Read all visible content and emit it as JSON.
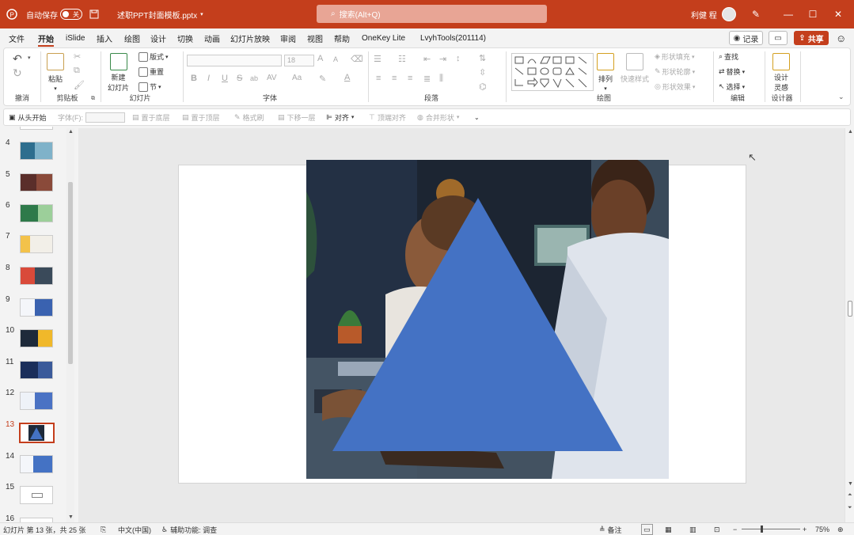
{
  "titlebar": {
    "autosave_label": "自动保存",
    "autosave_state": "关",
    "filename": "述职PPT封面模板.pptx",
    "search_placeholder": "搜索(Alt+Q)",
    "user_name": "利健 程"
  },
  "tabs": [
    "文件",
    "开始",
    "iSlide",
    "插入",
    "绘图",
    "设计",
    "切换",
    "动画",
    "幻灯片放映",
    "审阅",
    "视图",
    "帮助",
    "OneKey Lite",
    "LvyhTools(201114)"
  ],
  "record_label": "记录",
  "share_label": "共享",
  "ribbon": {
    "groups": [
      "撤消",
      "剪贴板",
      "幻灯片",
      "字体",
      "段落",
      "绘图",
      "编辑",
      "设计器"
    ],
    "paste": "粘贴",
    "new_slide": [
      "新建",
      "幻灯片"
    ],
    "layout": "版式",
    "reset": "重置",
    "section": "节",
    "arrange": "排列",
    "quick_styles": "快速样式",
    "shape_fill": "形状填充",
    "shape_outline": "形状轮廓",
    "shape_effects": "形状效果",
    "find": "查找",
    "replace": "替换",
    "select": "选择",
    "designer": [
      "设计",
      "灵感"
    ],
    "font_size": "18",
    "font_buttons": [
      "B",
      "I",
      "U",
      "S",
      "ab",
      "AV",
      "Aa"
    ],
    "grow_font": "A",
    "shrink_font": "A"
  },
  "qat": {
    "from_start": "从头开始",
    "font_label": "字体(F):",
    "bring_back": "置于底层",
    "bring_front": "置于顶层",
    "format_painter": "格式刷",
    "move_down": "下移一层",
    "align": "对齐",
    "align_top": "顶端对齐",
    "merge_shapes": "合并形状"
  },
  "thumbnails": {
    "numbers": [
      "4",
      "5",
      "6",
      "7",
      "8",
      "9",
      "10",
      "11",
      "12",
      "13",
      "14",
      "15",
      "16"
    ],
    "active": "13"
  },
  "status": {
    "slide_info": "幻灯片 第 13 张，共 25 张",
    "language": "中文(中国)",
    "accessibility": "辅助功能: 调查",
    "notes": "备注",
    "zoom": "75%",
    "zoom_minus": "−",
    "zoom_plus": "+"
  },
  "colors": {
    "brand": "#c43e1c",
    "triangle": "#4472c4"
  }
}
